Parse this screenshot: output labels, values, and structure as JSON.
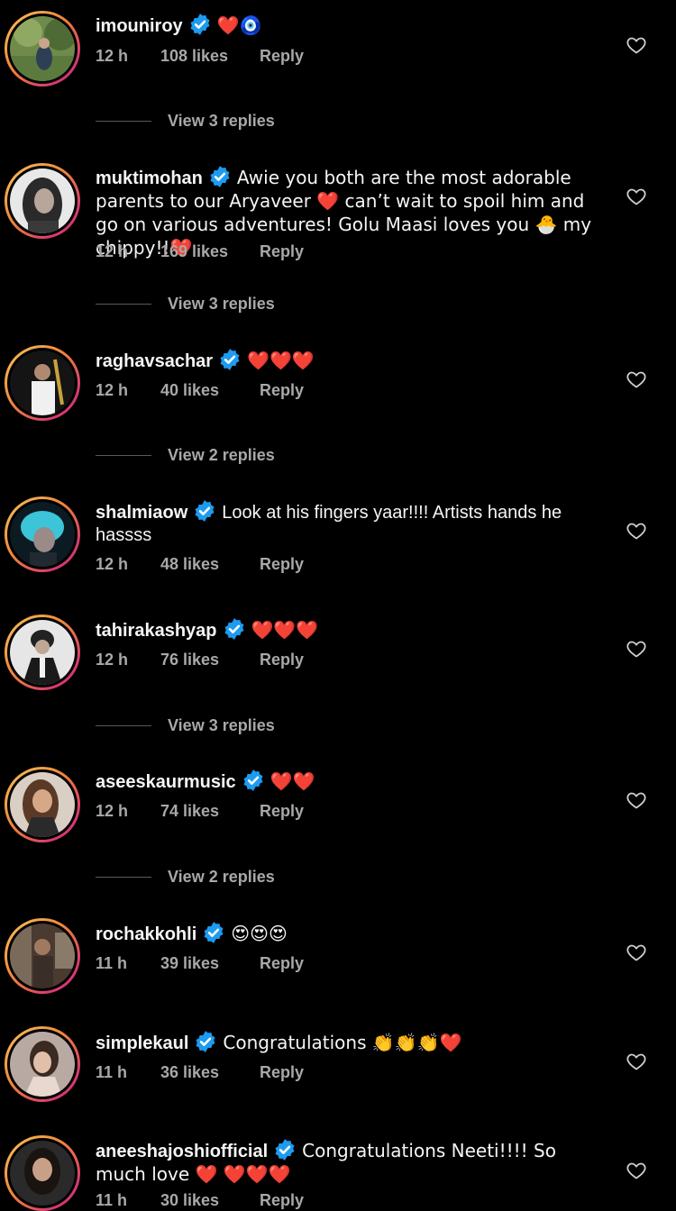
{
  "colors": {
    "background": "#000000",
    "text_primary": "#f5f5f5",
    "text_secondary": "#a8a8a8",
    "verified_blue": "#1d9bf0",
    "heart_red": "#ff2d55"
  },
  "comments": [
    {
      "username": "imouniroy",
      "text": "❤️🧿",
      "time": "12 h",
      "likes": "108 likes",
      "reply_label": "Reply",
      "view_replies": "View 3 replies"
    },
    {
      "username": "muktimohan",
      "text": "Awie you both are the most adorable parents to our Aryaveer ❤️ can’t wait to spoil him and go on various adventures! Golu Maasi loves you 🐣 my chippy!!❤️",
      "time": "12 h",
      "likes": "169 likes",
      "reply_label": "Reply",
      "view_replies": "View 3 replies"
    },
    {
      "username": "raghavsachar",
      "text": "❤️❤️❤️",
      "time": "12 h",
      "likes": "40 likes",
      "reply_label": "Reply",
      "view_replies": "View 2 replies"
    },
    {
      "username": "shalmiaow",
      "text": "Look at his fingers yaar!!!! Artists hands he hassss",
      "time": "12 h",
      "likes": "48 likes",
      "reply_label": "Reply"
    },
    {
      "username": "tahirakashyap",
      "text": "❤️❤️❤️",
      "time": "12 h",
      "likes": "76 likes",
      "reply_label": "Reply",
      "view_replies": "View 3 replies"
    },
    {
      "username": "aseeskaurmusic",
      "text": "❤️❤️",
      "time": "12 h",
      "likes": "74 likes",
      "reply_label": "Reply",
      "view_replies": "View 2 replies"
    },
    {
      "username": "rochakkohli",
      "text": "😍😍😍",
      "time": "11 h",
      "likes": "39 likes",
      "reply_label": "Reply"
    },
    {
      "username": "simplekaul",
      "text": "Congratulations 👏👏👏❤️",
      "time": "11 h",
      "likes": "36 likes",
      "reply_label": "Reply"
    },
    {
      "username": "aneeshajoshiofficial",
      "text": "Congratulations Neeti!!!! So much love ❤️ ❤️❤️❤️",
      "time": "11 h",
      "likes": "30 likes",
      "reply_label": "Reply"
    }
  ]
}
